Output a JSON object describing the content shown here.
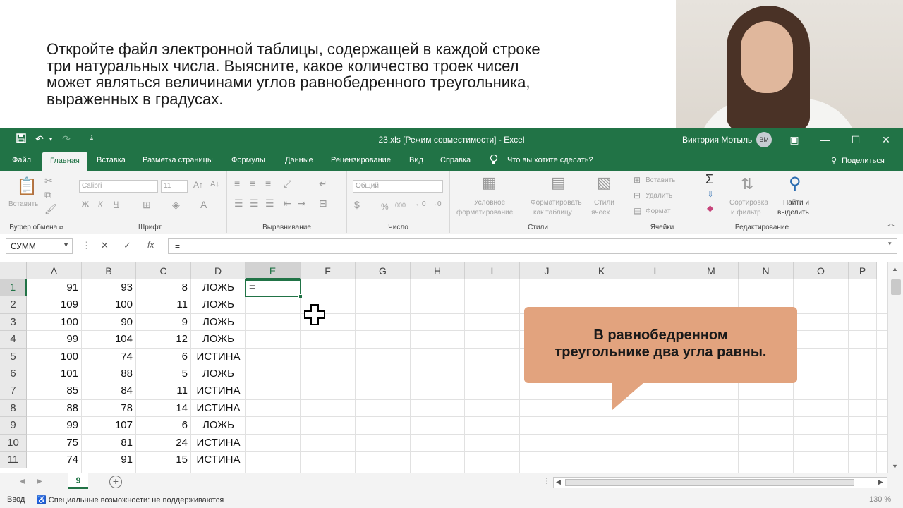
{
  "slide": {
    "task_lines": [
      "Откройте файл электронной таблицы, содержащей в каждой строке",
      "три натуральных числа. Выясните, какое количество троек чисел",
      "может являться величинами углов равнобедренного треугольника,",
      "выраженных в градусах."
    ]
  },
  "callout": {
    "line1": "В равнобедренном",
    "line2": "треугольнике два угла равны."
  },
  "titlebar": {
    "title": "23.xls  [Режим совместимости]  -  Excel",
    "user": "Виктория Мотыль",
    "avatar": "ВМ",
    "save_icon": "save-icon",
    "undo_icon": "undo-icon"
  },
  "tabs": {
    "file": "Файл",
    "home": "Главная",
    "insert": "Вставка",
    "layout": "Разметка страницы",
    "formulas": "Формулы",
    "data": "Данные",
    "review": "Рецензирование",
    "view": "Вид",
    "help": "Справка",
    "tell": "Что вы хотите сделать?",
    "share": "Поделиться"
  },
  "ribbon": {
    "clipboard": {
      "label": "Буфер обмена",
      "paste": "Вставить"
    },
    "font": {
      "label": "Шрифт",
      "name": "Calibri",
      "size": "11",
      "bold": "Ж",
      "italic": "К",
      "underline": "Ч"
    },
    "alignment": {
      "label": "Выравнивание"
    },
    "number": {
      "label": "Число",
      "format": "Общий",
      "percent": "%",
      "thousands": "000"
    },
    "styles": {
      "label": "Стили",
      "cond1": "Условное",
      "cond2": "форматирование",
      "table1": "Форматировать",
      "table2": "как таблицу",
      "cell1": "Стили",
      "cell2": "ячеек"
    },
    "cells": {
      "label": "Ячейки",
      "insert": "Вставить",
      "delete": "Удалить",
      "format": "Формат"
    },
    "editing": {
      "label": "Редактирование",
      "sort1": "Сортировка",
      "sort2": "и фильтр",
      "find1": "Найти и",
      "find2": "выделить"
    }
  },
  "formula_bar": {
    "name_box": "СУММ",
    "formula": "="
  },
  "sheet": {
    "columns": [
      "A",
      "B",
      "C",
      "D",
      "E",
      "F",
      "G",
      "H",
      "I",
      "J",
      "K",
      "L",
      "M",
      "N",
      "O",
      "P"
    ],
    "rows": [
      [
        "1",
        "91",
        "93",
        "8",
        "ЛОЖЬ"
      ],
      [
        "2",
        "109",
        "100",
        "11",
        "ЛОЖЬ"
      ],
      [
        "3",
        "100",
        "90",
        "9",
        "ЛОЖЬ"
      ],
      [
        "4",
        "99",
        "104",
        "12",
        "ЛОЖЬ"
      ],
      [
        "5",
        "100",
        "74",
        "6",
        "ИСТИНА"
      ],
      [
        "6",
        "101",
        "88",
        "5",
        "ЛОЖЬ"
      ],
      [
        "7",
        "85",
        "84",
        "11",
        "ИСТИНА"
      ],
      [
        "8",
        "88",
        "78",
        "14",
        "ИСТИНА"
      ],
      [
        "9",
        "99",
        "107",
        "6",
        "ЛОЖЬ"
      ],
      [
        "10",
        "75",
        "81",
        "24",
        "ИСТИНА"
      ],
      [
        "11",
        "74",
        "91",
        "15",
        "ИСТИНА"
      ]
    ],
    "active_cell_text": "=",
    "tab_name": "9"
  },
  "status": {
    "mode": "Ввод",
    "accessibility": "Специальные возможности: не поддерживаются",
    "zoom": "130 %"
  },
  "colors": {
    "excel_green": "#217346",
    "callout": "#e2a37e"
  }
}
